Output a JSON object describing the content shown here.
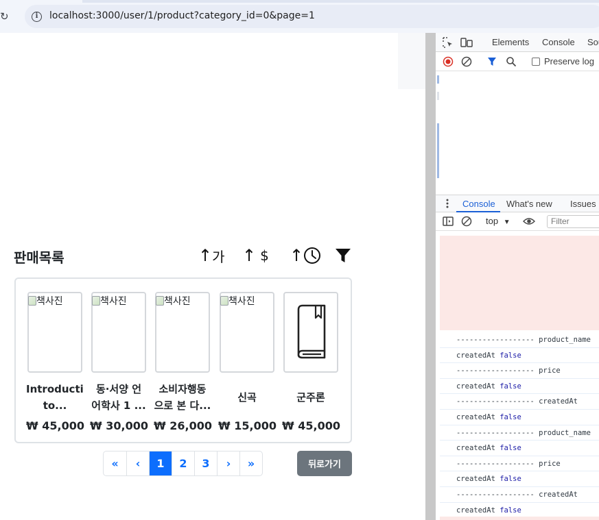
{
  "browser": {
    "url": "localhost:3000/user/1/product?category_id=0&page=1"
  },
  "page": {
    "title": "판매목록",
    "sort": {
      "name_label": "가",
      "price_label": "$"
    },
    "products": [
      {
        "name": "Introductio\nto...",
        "price": "₩ 45,000",
        "alt": "책사진",
        "image": "broken"
      },
      {
        "name": "동·서양 언\n어학사 1 ...",
        "price": "₩ 30,000",
        "alt": "책사진",
        "image": "broken"
      },
      {
        "name": "소비자행동\n으로 본 다...",
        "price": "₩ 26,000",
        "alt": "책사진",
        "image": "broken"
      },
      {
        "name": "신곡",
        "price": "₩ 15,000",
        "alt": "책사진",
        "image": "broken"
      },
      {
        "name": "군주론",
        "price": "₩ 45,000",
        "alt": "",
        "image": "book-icon"
      }
    ],
    "pagination": {
      "first": "«",
      "prev": "‹",
      "pages": [
        "1",
        "2",
        "3"
      ],
      "active_page": "1",
      "next": "›",
      "last": "»"
    },
    "back_button": "뒤로가기"
  },
  "devtools": {
    "tabs": [
      "Elements",
      "Console",
      "Sou"
    ],
    "preserve_log": "Preserve log",
    "drawer_tabs": [
      "Console",
      "What's new",
      "Issues"
    ],
    "context": "top",
    "filter_placeholder": "Filter",
    "logs": [
      {
        "text": "------------------ product_name",
        "bool": ""
      },
      {
        "text": "createdAt ",
        "bool": "false"
      },
      {
        "text": "------------------ price",
        "bool": ""
      },
      {
        "text": "createdAt ",
        "bool": "false"
      },
      {
        "text": "------------------ createdAt",
        "bool": ""
      },
      {
        "text": "createdAt ",
        "bool": "false"
      },
      {
        "text": "------------------ product_name",
        "bool": ""
      },
      {
        "text": "createdAt ",
        "bool": "false"
      },
      {
        "text": "------------------ price",
        "bool": ""
      },
      {
        "text": "createdAt ",
        "bool": "false"
      },
      {
        "text": "------------------ createdAt",
        "bool": ""
      },
      {
        "text": "createdAt ",
        "bool": "false"
      }
    ]
  }
}
